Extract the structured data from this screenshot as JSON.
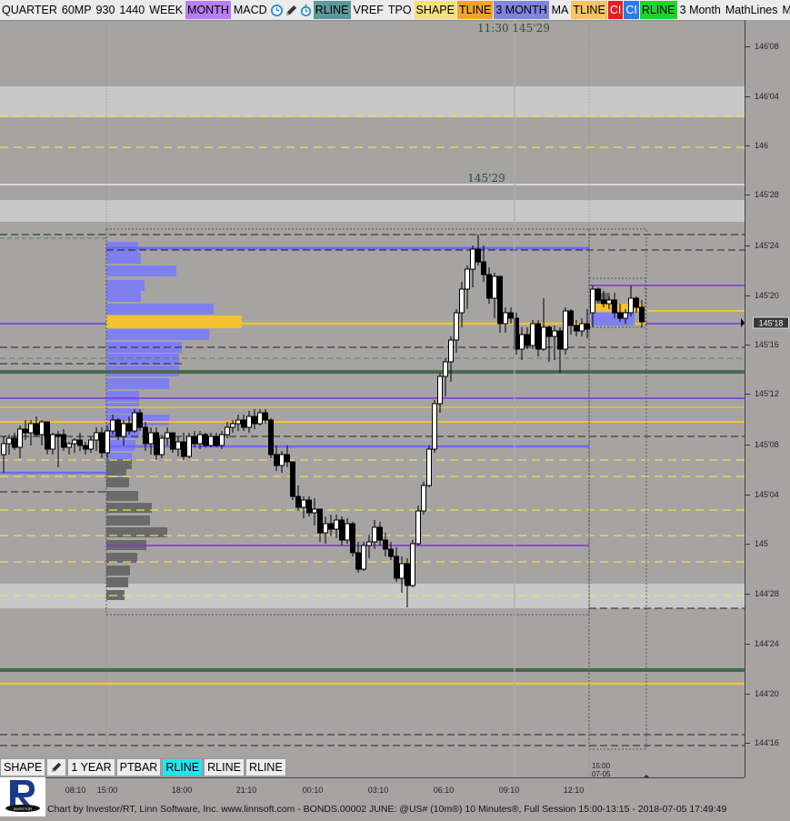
{
  "toolbar": {
    "items": [
      {
        "label": "QUARTER",
        "bg": "#ebebeb",
        "fg": "#000000"
      },
      {
        "label": "60MP",
        "bg": "#ebebeb",
        "fg": "#000000"
      },
      {
        "label": "930",
        "bg": "#ebebeb",
        "fg": "#000000"
      },
      {
        "label": "1440",
        "bg": "#ebebeb",
        "fg": "#000000"
      },
      {
        "label": "WEEK",
        "bg": "#ebebeb",
        "fg": "#000000"
      },
      {
        "label": "MONTH",
        "bg": "#b97ef7",
        "fg": "#000000"
      },
      {
        "label": "MACD",
        "bg": "#ebebeb",
        "fg": "#000000"
      }
    ],
    "icons": [
      "clock-icon",
      "pencil-icon",
      "stopwatch-icon"
    ],
    "items2": [
      {
        "label": "RLINE",
        "bg": "#5b9a99",
        "fg": "#000000"
      },
      {
        "label": "VREF",
        "bg": "#ebebeb",
        "fg": "#000000"
      },
      {
        "label": "TPO",
        "bg": "#ebebeb",
        "fg": "#000000"
      },
      {
        "label": "SHAPE",
        "bg": "#f3e27c",
        "fg": "#000000"
      },
      {
        "label": "TLINE",
        "bg": "#f4a32a",
        "fg": "#000000"
      },
      {
        "label": "3 MONTH",
        "bg": "#7f86e0",
        "fg": "#000000"
      },
      {
        "label": "MA",
        "bg": "#ebebeb",
        "fg": "#000000"
      },
      {
        "label": "TLINE",
        "bg": "#f7c462",
        "fg": "#000000"
      },
      {
        "label": "CI",
        "bg": "#e02020",
        "fg": "#ffffff"
      },
      {
        "label": "CI",
        "bg": "#2a7de8",
        "fg": "#ffffff"
      },
      {
        "label": "RLINE",
        "bg": "#21d42b",
        "fg": "#000000"
      },
      {
        "label": "3 Month",
        "bg": "#ebebeb",
        "fg": "#000000"
      },
      {
        "label": "MathLines",
        "bg": "#ebebeb",
        "fg": "#000000"
      },
      {
        "label": "M",
        "bg": "#ebebeb",
        "fg": "#000000"
      }
    ]
  },
  "price_axis": {
    "labels": [
      "146'08",
      "146'04",
      "146",
      "145'28",
      "145'24",
      "145'20",
      "145'16",
      "145'12",
      "145'08",
      "145'04",
      "145",
      "144'28",
      "144'24",
      "144'20",
      "144'16"
    ],
    "current_price": "145'18"
  },
  "crosshair": {
    "time_price": "11:30  145'29",
    "price_label": "145'29"
  },
  "time_axis": {
    "labels": [
      "08:10",
      "15:00",
      "18:00",
      "21:10",
      "00:10",
      "03:10",
      "06:10",
      "09:10",
      "12:10",
      "15:00"
    ],
    "session_marker": [
      "15:00",
      "07-05"
    ]
  },
  "bottom_toolbar": [
    {
      "label": "SHAPE",
      "bg": "#ededed"
    },
    {
      "label": "pencil-icon",
      "bg": "#ededed",
      "icon": true
    },
    {
      "label": "1 YEAR",
      "bg": "#ededed"
    },
    {
      "label": "PTBAR",
      "bg": "#ededed"
    },
    {
      "label": "RLINE",
      "bg": "#22e6ee"
    },
    {
      "label": "RLINE",
      "bg": "#ededed"
    },
    {
      "label": "RLINE",
      "bg": "#ededed"
    }
  ],
  "footer": "Chart by Investor/RT, Linn Software, Inc. www.linnsoft.com - BONDS.00002 JUNE: @US# (10m®) 10 Minutes®, Full Session 15:00-13:15 - 2018-07-05 17:49:49",
  "colors": {
    "background": "#a6a3a3",
    "zone": "#c8c8c8",
    "yellow": "#f2c230",
    "blue": "#6b6bf2",
    "purple": "#7a35e0",
    "green": "#4a6a4a",
    "gray_profile": "#6a6a6a"
  }
}
